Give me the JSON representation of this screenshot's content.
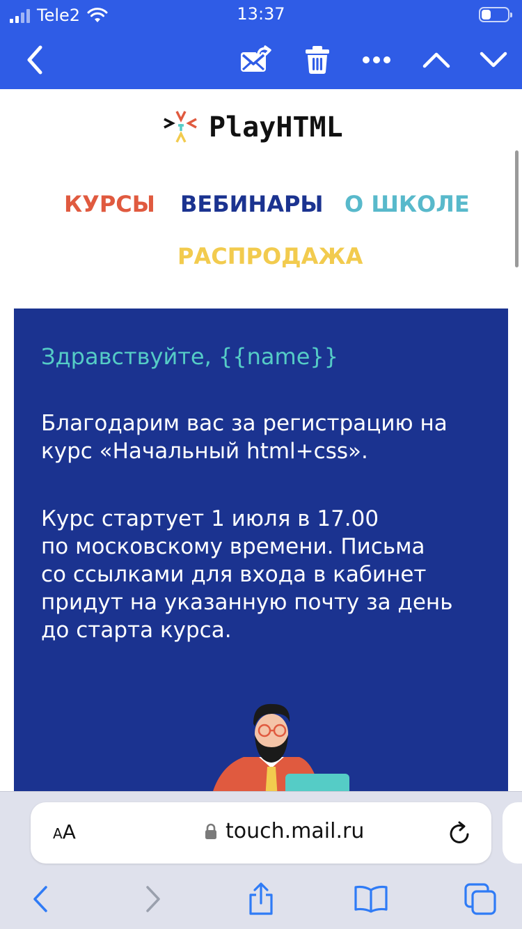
{
  "status_bar": {
    "carrier": "Tele2",
    "time": "13:37",
    "battery_level": 0.35
  },
  "mail_toolbar": {
    "icons": [
      "back-chevron-icon",
      "move-to-folder-icon",
      "trash-icon",
      "more-icon",
      "previous-message-icon",
      "next-message-icon"
    ]
  },
  "email": {
    "logo_text": "PlayHTML",
    "nav": {
      "courses": "КУРСЫ",
      "webinars": "ВЕБИНАРЫ",
      "about": "О ШКОЛЕ",
      "sale": "РАСПРОДАЖА"
    },
    "greeting": "Здравствуйте, {{name}}",
    "paragraph1_lines": [
      "Благодарим вас за регистрацию на",
      "курс «Начальный html+css»."
    ],
    "paragraph2_lines": [
      "Курс стартует 1 июля в 17.00",
      "по московскому времени. Письма",
      "со ссылками для входа в кабинет",
      "придут на указанную почту за день",
      "до старта курса."
    ]
  },
  "browser": {
    "aa_label_small": "A",
    "aa_label_large": "A",
    "url": "touch.mail.ru"
  },
  "colors": {
    "toolbar_blue": "#2f5ce6",
    "banner_blue": "#1b3390",
    "greeting_teal": "#55ccc6",
    "nav_courses": "#e05a3f",
    "nav_webinars": "#1b3390",
    "nav_about": "#58b9cb",
    "nav_sale": "#f2cb4e",
    "ios_link_blue": "#2f7bf6"
  }
}
